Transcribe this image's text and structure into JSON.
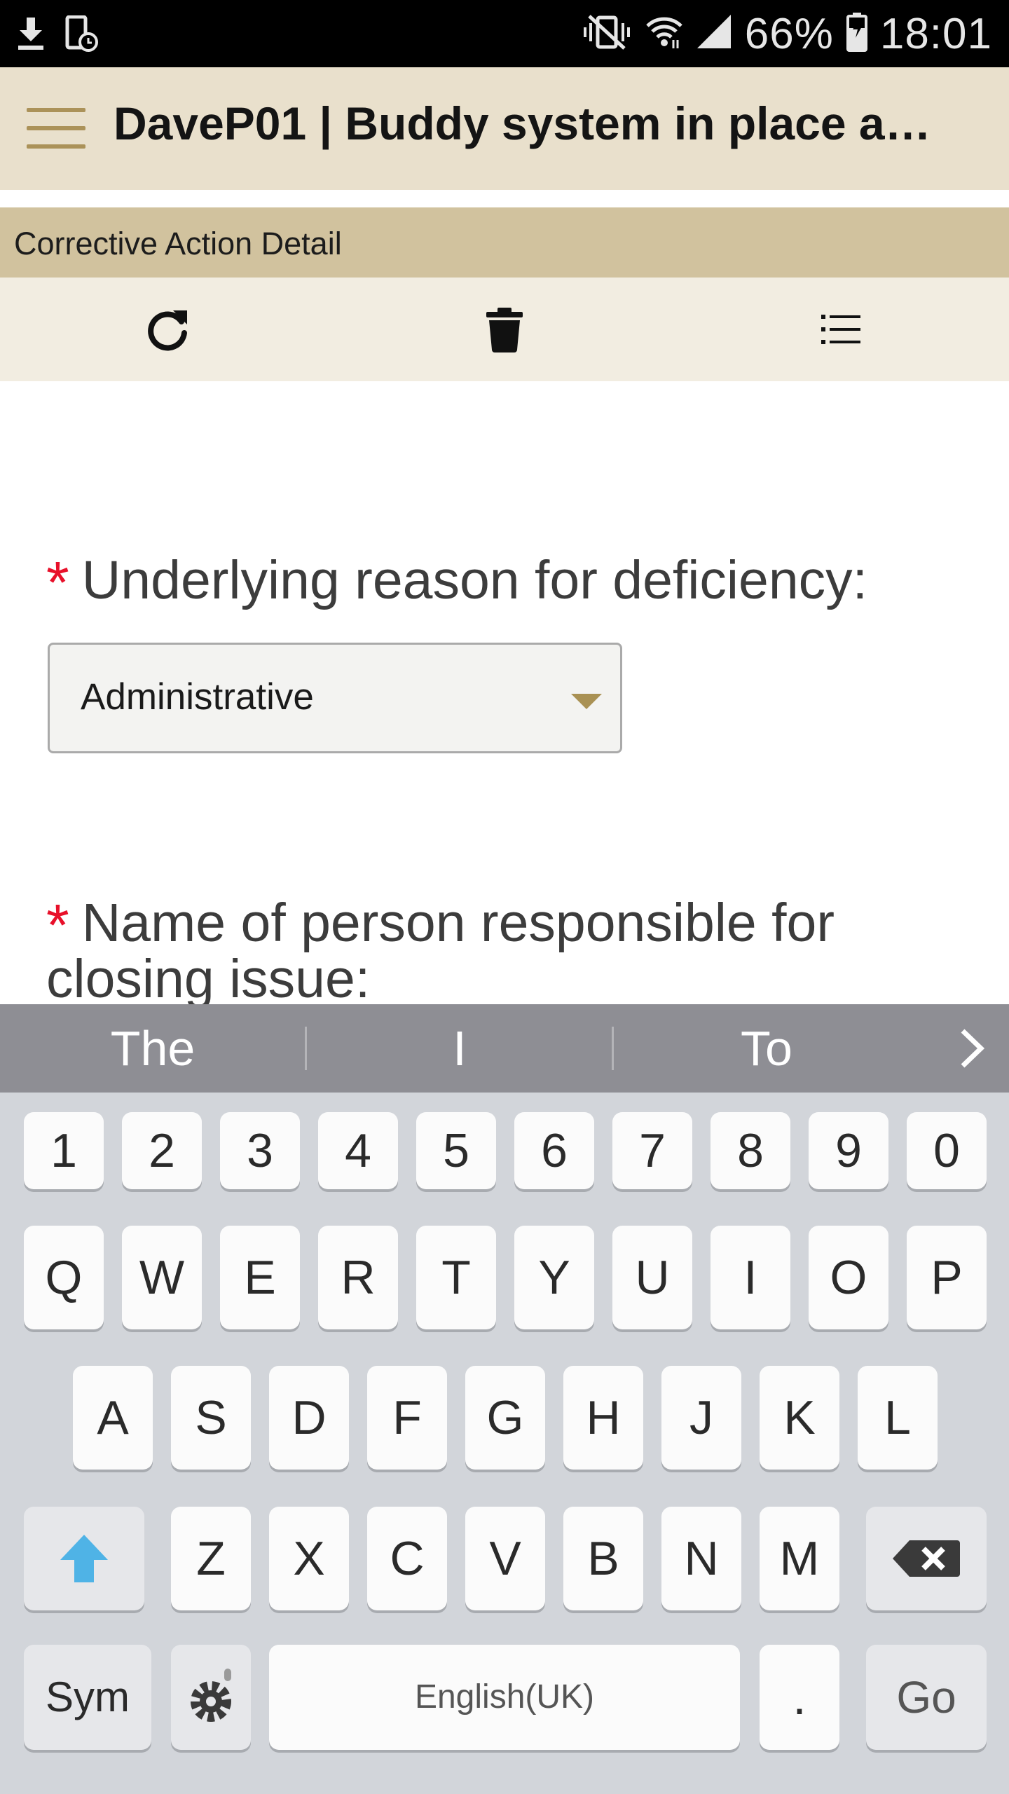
{
  "status_bar": {
    "battery": "66%",
    "time": "18:01",
    "icons": [
      "download-icon",
      "phone-sync-icon",
      "vibrate-mute-icon",
      "wifi-icon",
      "signal-icon",
      "battery-charging-icon"
    ]
  },
  "app_bar": {
    "title": "DaveP01 | Buddy system in place a…",
    "menu_icon": "hamburger-menu-icon"
  },
  "section": {
    "title": "Corrective Action Detail"
  },
  "toolbar": {
    "icons": [
      "refresh-icon",
      "trash-icon",
      "list-icon"
    ]
  },
  "form": {
    "required_marker": "*",
    "reason_label": "Underlying reason for deficiency:",
    "reason_value": "Administrative",
    "responsible_label": "Name of person responsible for closing issue:"
  },
  "keyboard": {
    "suggestions": [
      "The",
      "I",
      "To"
    ],
    "number_row": [
      "1",
      "2",
      "3",
      "4",
      "5",
      "6",
      "7",
      "8",
      "9",
      "0"
    ],
    "row1": [
      "Q",
      "W",
      "E",
      "R",
      "T",
      "Y",
      "U",
      "I",
      "O",
      "P"
    ],
    "row2": [
      "A",
      "S",
      "D",
      "F",
      "G",
      "H",
      "J",
      "K",
      "L"
    ],
    "row3": [
      "Z",
      "X",
      "C",
      "V",
      "B",
      "N",
      "M"
    ],
    "sym_label": "Sym",
    "space_label": "English(UK)",
    "period_label": ".",
    "go_label": "Go"
  },
  "colors": {
    "app_bar_bg": "#e9e0cc",
    "section_bg": "#d1c29e",
    "toolbar_bg": "#f2ede1",
    "accent": "#ab9259",
    "required": "#e8102a",
    "shift_accent": "#4fb3e6"
  }
}
